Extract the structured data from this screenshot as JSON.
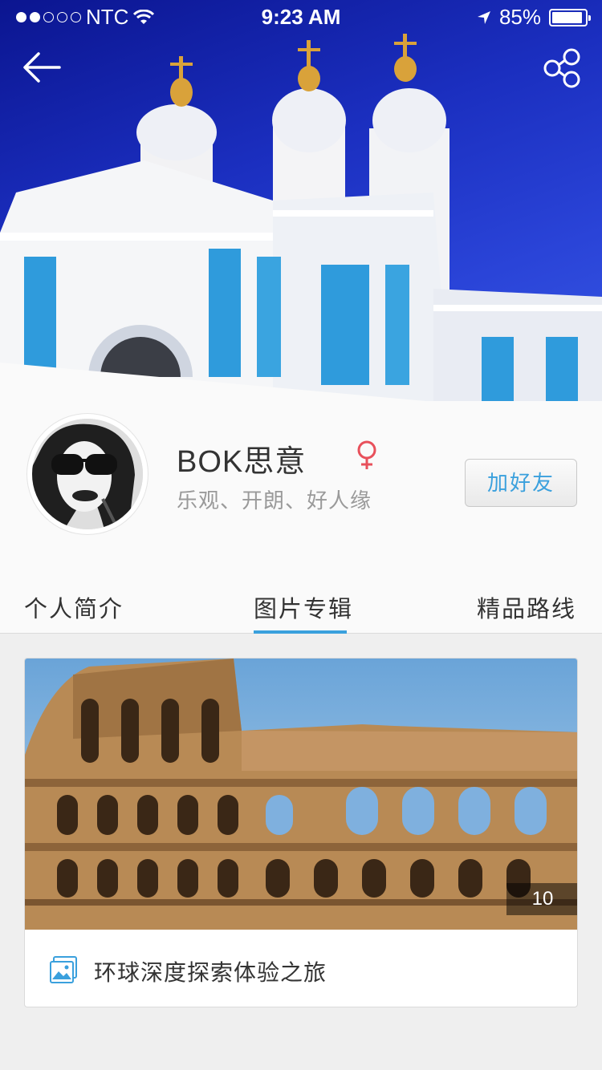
{
  "status_bar": {
    "carrier": "NTC",
    "time": "9:23 AM",
    "battery": "85%",
    "signal_icon": "signal-dots-icon",
    "wifi_icon": "wifi-icon",
    "location_icon": "location-arrow-icon",
    "battery_level": 0.85
  },
  "header": {
    "back_icon": "back-arrow-icon",
    "share_icon": "share-icon"
  },
  "profile": {
    "name": "BOK思意",
    "gender_icon": "female-icon",
    "tagline": "乐观、开朗、好人缘",
    "add_friend_label": "加好友"
  },
  "tabs": [
    {
      "label": "个人简介",
      "active": false
    },
    {
      "label": "图片专辑",
      "active": true
    },
    {
      "label": "精品路线",
      "active": false
    }
  ],
  "albums": [
    {
      "title": "环球深度探索体验之旅",
      "photo_count": "10",
      "icon": "image-album-icon"
    }
  ],
  "colors": {
    "accent": "#3aa0dd",
    "female": "#e8505b",
    "text": "#333333",
    "muted": "#9a9a9a"
  }
}
